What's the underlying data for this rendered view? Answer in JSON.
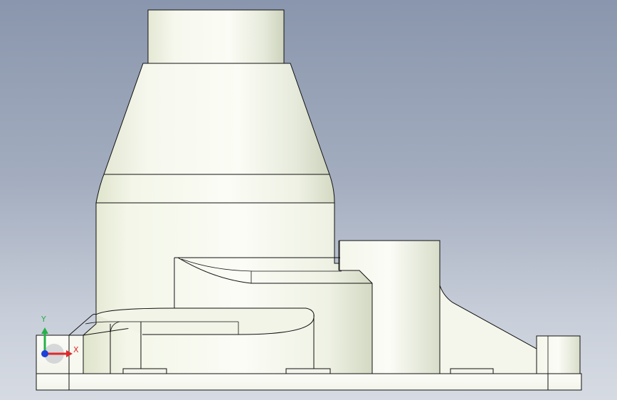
{
  "viewport": {
    "background_top": "#8a96ad",
    "background_bottom": "#d6dbe3"
  },
  "model": {
    "fill_light": "#f7f9ef",
    "fill_mid": "#e9eddc",
    "fill_shadow": "#c9cfb6",
    "edge_color": "#111111"
  },
  "triad": {
    "x_label": "X",
    "y_label": "Y",
    "x_color": "#e0282a",
    "y_color": "#27b04a",
    "origin_color": "#1e3fd8"
  }
}
